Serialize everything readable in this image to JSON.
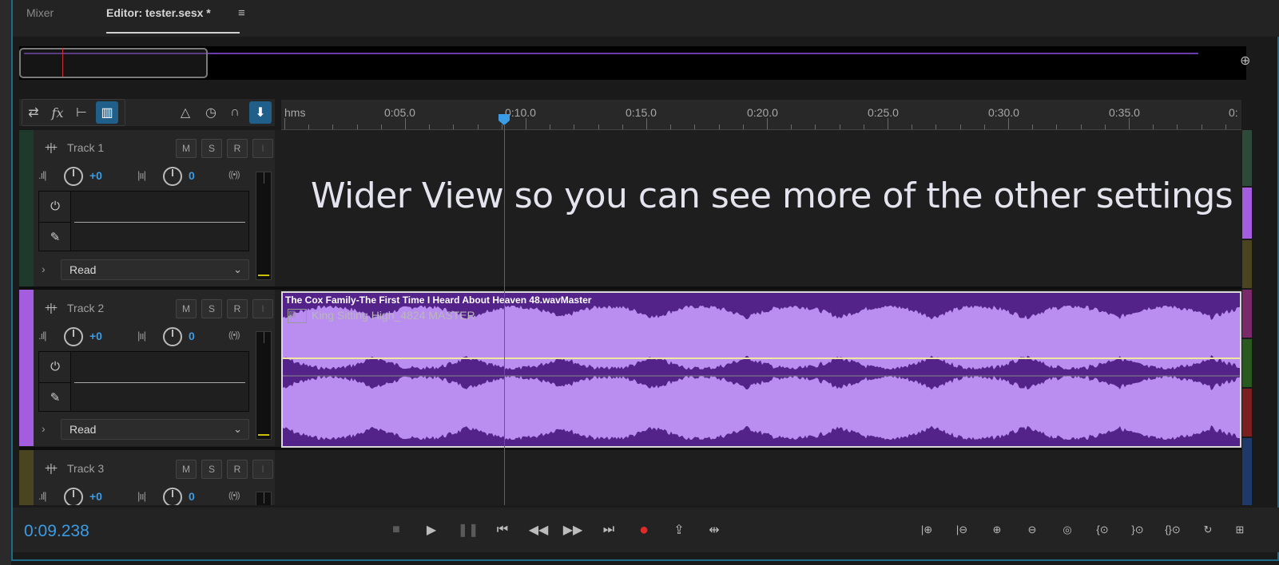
{
  "tabs": {
    "mixer": "Mixer",
    "editor": "Editor: tester.sesx *",
    "menu_icon": "hamburger-icon"
  },
  "toolbar": {
    "icons": [
      "switch-icon",
      "fx-icon",
      "send-icon",
      "eq-icon",
      "metronome-icon",
      "timer-icon",
      "headphones-icon",
      "marker-icon"
    ]
  },
  "ruler": {
    "labels": [
      "hms",
      "0:05.0",
      "0:10.0",
      "0:15.0",
      "0:20.0",
      "0:25.0",
      "0:30.0",
      "0:35.0",
      "0:"
    ]
  },
  "tracks": [
    {
      "name": "Track 1",
      "m": "M",
      "s": "S",
      "r": "R",
      "i": "I",
      "volume": "+0",
      "pan": "0",
      "mode": "Read",
      "color": "#1f3a2c"
    },
    {
      "name": "Track 2",
      "m": "M",
      "s": "S",
      "r": "R",
      "i": "I",
      "volume": "+0",
      "pan": "0",
      "mode": "Read",
      "color": "#a55de0"
    },
    {
      "name": "Track 3",
      "m": "M",
      "s": "S",
      "r": "R",
      "i": "I",
      "volume": "+0",
      "pan": "0",
      "color": "#4a4420"
    }
  ],
  "overlay": {
    "text": "Wider View so you can see more of the other settings"
  },
  "clip": {
    "title": "The Cox Family-The First Time I Heard About Heaven 48.wavMaster",
    "subtitle": "King Sitting High_4824 MASTER",
    "color": "#53238a",
    "wave_color": "#b98ef0"
  },
  "transport": {
    "time": "0:09.238"
  },
  "colors": {
    "accent": "#3b9ce6",
    "playhead": "#d03030",
    "record": "#e02a2a"
  }
}
